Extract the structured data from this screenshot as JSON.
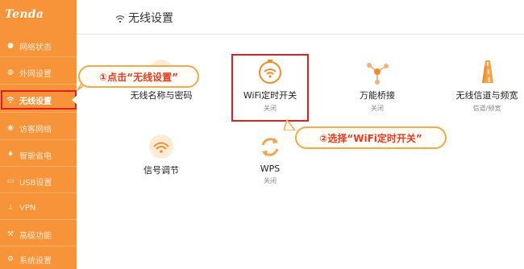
{
  "brand": {
    "logo": "Tenda"
  },
  "sidebar": {
    "items": [
      {
        "label": "网络状态",
        "icon": "user-icon"
      },
      {
        "label": "外网设置",
        "icon": "globe-icon"
      },
      {
        "label": "无线设置",
        "icon": "wifi-icon",
        "active": true
      },
      {
        "label": "访客网络",
        "icon": "guest-icon"
      },
      {
        "label": "智能省电",
        "icon": "bulb-icon"
      },
      {
        "label": "USB设置",
        "icon": "usb-icon"
      },
      {
        "label": "VPN",
        "icon": "vpn-icon"
      },
      {
        "label": "高级功能",
        "icon": "tools-icon"
      },
      {
        "label": "系统设置",
        "icon": "gear-icon"
      }
    ]
  },
  "header": {
    "title": "无线设置"
  },
  "tiles": [
    {
      "name": "无线名称与密码",
      "sub": ""
    },
    {
      "name": "WiFi定时开关",
      "sub": "关闭"
    },
    {
      "name": "万能桥接",
      "sub": "关闭"
    },
    {
      "name": "无线信道与频宽",
      "sub": "信道/频宽"
    },
    {
      "name": "信号调节",
      "sub": ""
    },
    {
      "name": "WPS",
      "sub": "关闭"
    }
  ],
  "callouts": {
    "step1": "①点击“无线设置”",
    "step2": "②选择“WiFi定时开关”"
  },
  "colors": {
    "accent": "#f7943a",
    "highlight": "#e02020",
    "callout_text": "#e63b1e"
  }
}
